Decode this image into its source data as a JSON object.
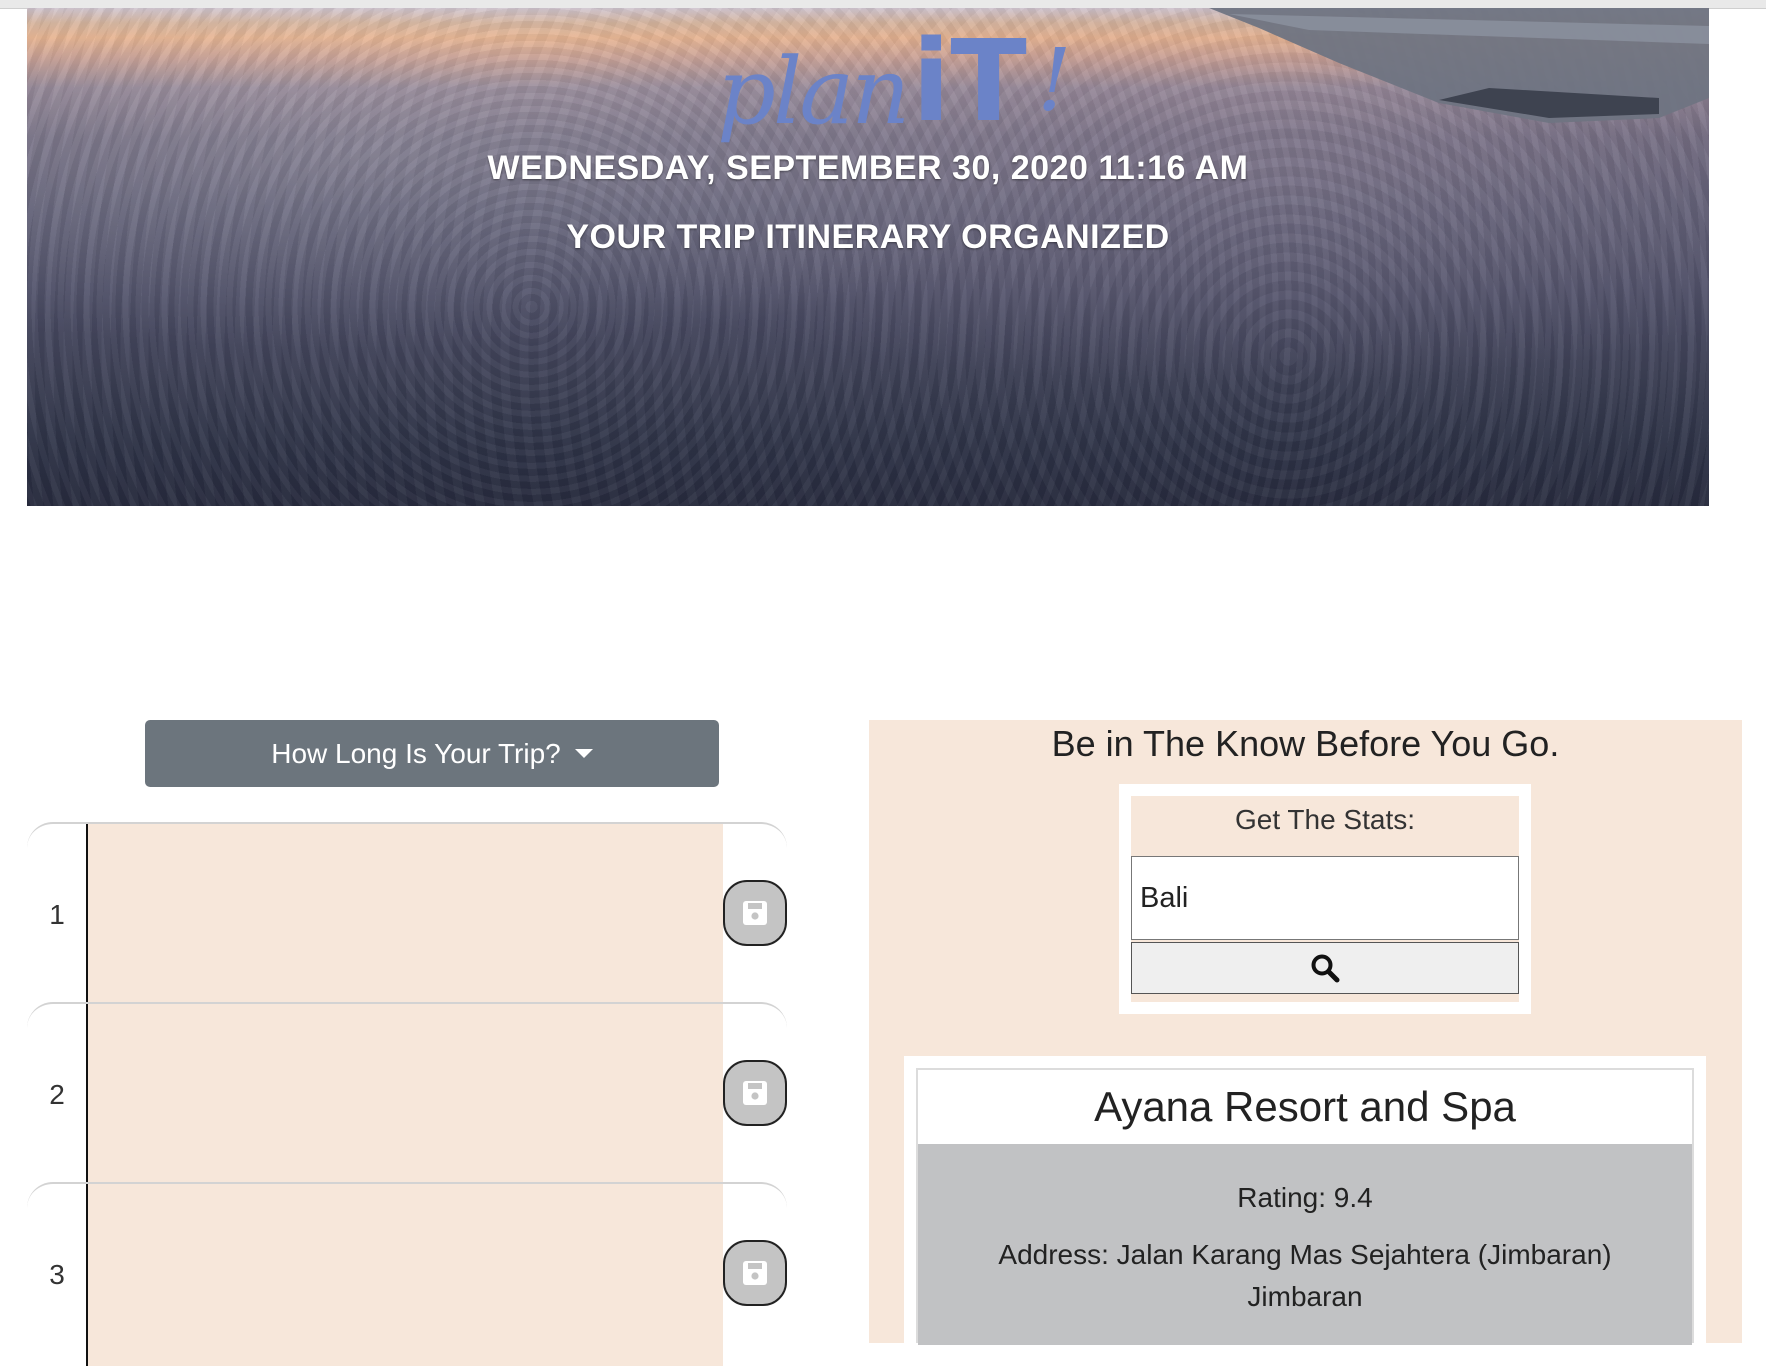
{
  "header": {
    "logo": {
      "plan": "plan",
      "it": "iT",
      "exclaim": "!"
    },
    "date_time": "WEDNESDAY, SEPTEMBER 30, 2020 11:16 AM",
    "tagline": "YOUR TRIP ITINERARY ORGANIZED"
  },
  "planner": {
    "dropdown_label": "How Long Is Your Trip?",
    "rows": [
      {
        "number": "1",
        "text": ""
      },
      {
        "number": "2",
        "text": ""
      },
      {
        "number": "3",
        "text": ""
      }
    ]
  },
  "stats": {
    "heading": "Be in The Know Before You Go.",
    "label": "Get The Stats:",
    "input_value": "Bali"
  },
  "hotel": {
    "name": "Ayana Resort and Spa",
    "rating": "Rating: 9.4",
    "address_line1": "Address: Jalan Karang Mas Sejahtera (Jimbaran)",
    "address_line2": "Jimbaran"
  },
  "colors": {
    "accent": "#6b83c8",
    "panel_bg": "#f7e7da",
    "button_gray": "#6c757d",
    "hotel_body": "#c1c2c4"
  }
}
